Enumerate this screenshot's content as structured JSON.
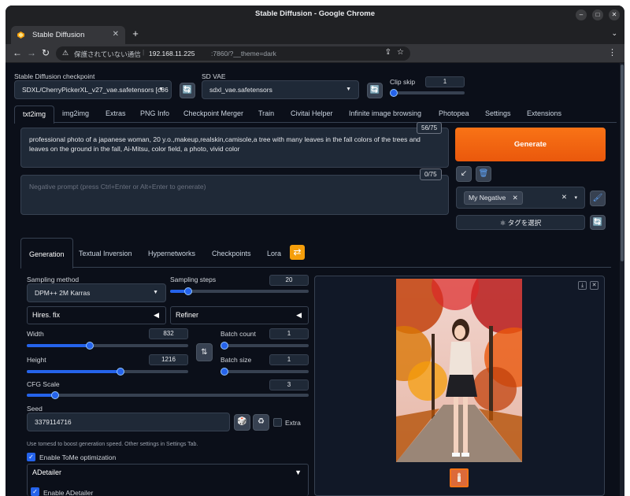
{
  "window": {
    "title": "Stable Diffusion - Google Chrome"
  },
  "browser": {
    "tab_title": "Stable Diffusion",
    "security_text": "保護されていない通信",
    "url_host": "192.168.11.225",
    "url_rest": ":7860/?__theme=dark"
  },
  "top": {
    "checkpoint_label": "Stable Diffusion checkpoint",
    "checkpoint_value": "SDXL/CherryPickerXL_v27_vae.safetensors [c86",
    "vae_label": "SD VAE",
    "vae_value": "sdxl_vae.safetensors",
    "clip_label": "Clip skip",
    "clip_value": "1"
  },
  "main_tabs": [
    "txt2img",
    "img2img",
    "Extras",
    "PNG Info",
    "Checkpoint Merger",
    "Train",
    "Civitai Helper",
    "Infinite image browsing",
    "Photopea",
    "Settings",
    "Extensions"
  ],
  "prompt": {
    "text": "professional photo of a japanese woman, 20 y.o.,makeup,realskin,camisole,a tree with many leaves in the fall colors of the trees and leaves on the ground in the fall, Ai-Mitsu, color field, a photo, vivid color",
    "counter": "56/75",
    "negative_placeholder": "Negative prompt (press Ctrl+Enter or Alt+Enter to generate)",
    "negative_counter": "0/75"
  },
  "actions": {
    "generate": "Generate",
    "styles_tag": "My Negative",
    "tag_select": "タグを選択"
  },
  "sub_tabs": [
    "Generation",
    "Textual Inversion",
    "Hypernetworks",
    "Checkpoints",
    "Lora"
  ],
  "generation": {
    "sampling_method_label": "Sampling method",
    "sampling_method_value": "DPM++ 2M Karras",
    "sampling_steps_label": "Sampling steps",
    "sampling_steps_value": "20",
    "hires_label": "Hires. fix",
    "refiner_label": "Refiner",
    "width_label": "Width",
    "width_value": "832",
    "height_label": "Height",
    "height_value": "1216",
    "batch_count_label": "Batch count",
    "batch_count_value": "1",
    "batch_size_label": "Batch size",
    "batch_size_value": "1",
    "cfg_label": "CFG Scale",
    "cfg_value": "3",
    "seed_label": "Seed",
    "seed_value": "3379114716",
    "extra_label": "Extra",
    "tome_hint": "Use tomesd to boost generation speed. Other settings in Settings Tab.",
    "tome_label": "Enable ToMe optimization",
    "adetailer_label": "ADetailer",
    "enable_adetailer_label": "Enable ADetailer"
  },
  "sliders": {
    "clip_skip": 0.0,
    "sampling_steps": 0.13,
    "width": 0.39,
    "height": 0.58,
    "batch_count": 0.0,
    "batch_size": 0.0,
    "cfg_scale": 0.1
  },
  "colors": {
    "accent": "#2563eb",
    "generate": "#f97316",
    "background": "#0b0f19"
  },
  "icons": {
    "refresh": "refresh-icon",
    "swap": "swap-icon",
    "dice": "dice-icon",
    "recycle": "recycle-icon",
    "arrow": "arrow-down-left-icon",
    "trash": "trash-icon",
    "brush": "brush-icon",
    "lora_toggle": "lora-toggle-icon"
  }
}
